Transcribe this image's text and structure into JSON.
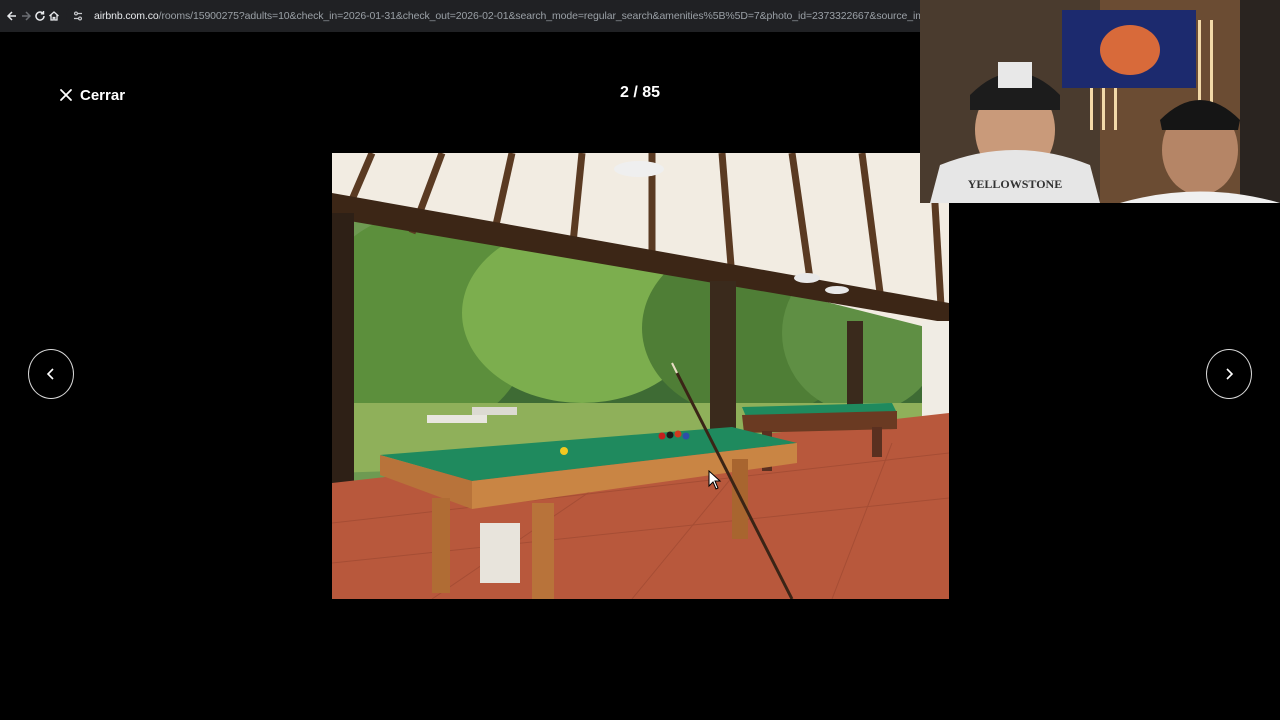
{
  "browser": {
    "url_domain": "airbnb.com.co",
    "url_path": "/rooms/15900275?adults=10&check_in=2026-01-31&check_out=2026-02-01&search_mode=regular_search&amenities%5B%5D=7&photo_id=2373322667&source_impr...",
    "icons": [
      "back-icon",
      "forward-icon",
      "reload-icon",
      "home-icon",
      "site-info-icon",
      "zoom-icon"
    ]
  },
  "gallery": {
    "close_label": "Cerrar",
    "counter": "2 / 85",
    "prev_icon": "chevron-left-icon",
    "next_icon": "chevron-right-icon"
  },
  "webcam": {
    "shirt_text": "YELLOWSTONE"
  },
  "colors": {
    "background": "#000000",
    "browser_bar": "#202124",
    "text": "#ffffff",
    "felt_green": "#1f8a5e",
    "wood": "#b8733a",
    "floor_tile": "#b8583c"
  }
}
